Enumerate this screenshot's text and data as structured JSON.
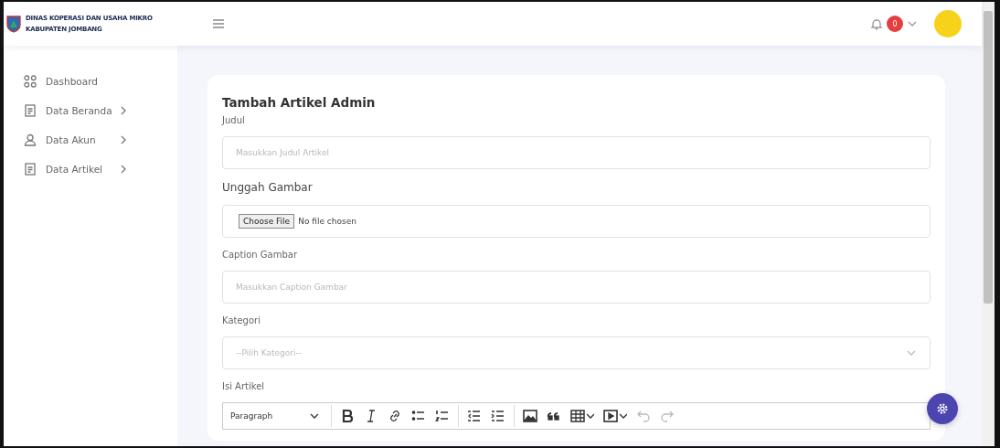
{
  "brand": {
    "line1": "DINAS KOPERASI DAN USAHA MIKRO",
    "line2": "KABUPATEN JOMBANG"
  },
  "header": {
    "notification_count": "0"
  },
  "sidebar": {
    "items": [
      {
        "label": "Dashboard",
        "kind": "dashboard",
        "has_submenu": false
      },
      {
        "label": "Data Beranda",
        "kind": "page",
        "has_submenu": true
      },
      {
        "label": "Data Akun",
        "kind": "account",
        "has_submenu": true
      },
      {
        "label": "Data Artikel",
        "kind": "page",
        "has_submenu": true
      }
    ]
  },
  "form": {
    "title": "Tambah Artikel Admin",
    "fields": [
      {
        "kind": "text",
        "label": "Judul",
        "placeholder": "Masukkan Judul Artikel"
      },
      {
        "kind": "file",
        "label": "Unggah Gambar",
        "button": "Choose File",
        "status": "No file chosen"
      },
      {
        "kind": "text",
        "label": "Caption Gambar",
        "placeholder": "Masukkan Caption Gambar"
      },
      {
        "kind": "select",
        "label": "Kategori",
        "placeholder": "--Pilih Kategori--"
      },
      {
        "kind": "editor",
        "label": "Isi Artikel",
        "format": "Paragraph",
        "tools": [
          {
            "kind": "separator"
          },
          {
            "kind": "bold"
          },
          {
            "kind": "italic"
          },
          {
            "kind": "link"
          },
          {
            "kind": "bullets"
          },
          {
            "kind": "numbers"
          },
          {
            "kind": "separator"
          },
          {
            "kind": "outdent"
          },
          {
            "kind": "indent"
          },
          {
            "kind": "separator"
          },
          {
            "kind": "image"
          },
          {
            "kind": "quote"
          },
          {
            "kind": "table",
            "dropdown": true
          },
          {
            "kind": "media",
            "dropdown": true
          },
          {
            "kind": "undo",
            "disabled": true
          },
          {
            "kind": "redo",
            "disabled": true
          }
        ]
      }
    ]
  }
}
